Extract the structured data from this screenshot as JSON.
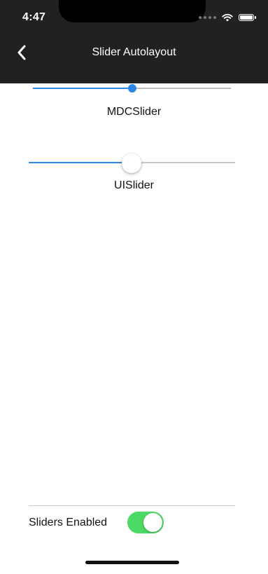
{
  "status_bar": {
    "time": "4:47",
    "icons": [
      "signal-dots-icon",
      "wifi-icon",
      "battery-icon"
    ]
  },
  "nav": {
    "title": "Slider Autolayout",
    "back_icon": "chevron-left-icon"
  },
  "sliders": {
    "mdc": {
      "label": "MDCSlider",
      "value": 0.5,
      "accent": "#2b86e4"
    },
    "ui": {
      "label": "UISlider",
      "value": 0.5,
      "accent": "#2b86e4"
    }
  },
  "footer": {
    "toggle_label": "Sliders Enabled",
    "toggle_on": true,
    "toggle_color": "#4cd964"
  }
}
